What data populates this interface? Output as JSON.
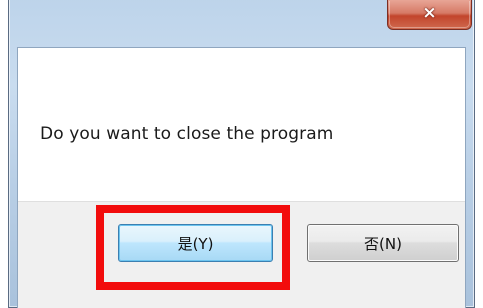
{
  "dialog": {
    "close_icon": "×",
    "message": "Do you want to close the program",
    "buttons": {
      "yes_label": "是(Y)",
      "no_label": "否(N)"
    }
  },
  "annotation": {
    "highlight_color": "#f20c0c",
    "target": "yes-button"
  },
  "colors": {
    "frame": "#c9dcef",
    "close_button": "#c2452c",
    "button_panel": "#f0f0f0",
    "default_button_border": "#3c7fb1"
  }
}
